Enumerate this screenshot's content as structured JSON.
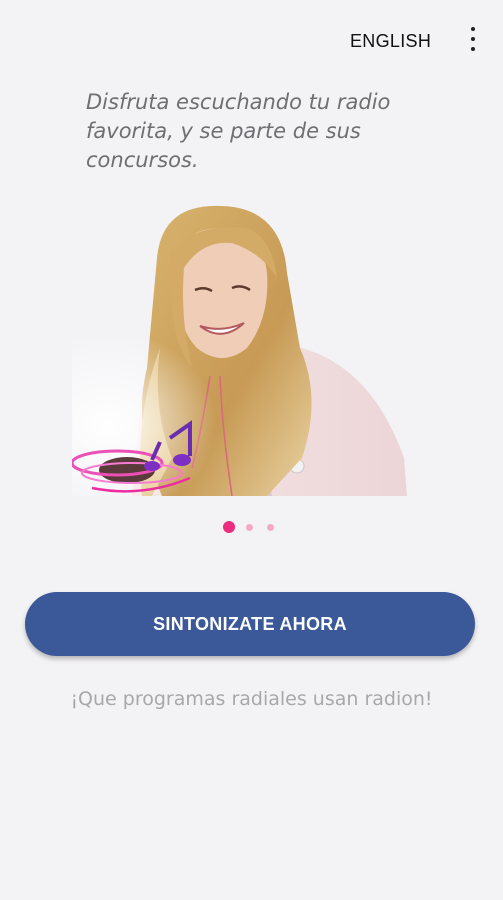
{
  "topbar": {
    "language_label": "ENGLISH",
    "menu_icon": "overflow-menu-icon"
  },
  "onboarding": {
    "tagline": "Disfruta escuchando tu radio favorita, y se parte de sus concursos.",
    "illustration_icon": "woman-listening-music-illustration",
    "pager": {
      "total": 3,
      "active_index": 0
    }
  },
  "actions": {
    "primary_label": "SINTONIZATE AHORA",
    "secondary_label": "¡Que programas radiales usan radion!"
  },
  "colors": {
    "background": "#f3f2f5",
    "primary_button": "#3b5898",
    "pager_active": "#ec2d7f",
    "pager_inactive": "#f7a8c8",
    "tagline_text": "#6e6e73",
    "secondary_text": "#a8a8ac"
  }
}
